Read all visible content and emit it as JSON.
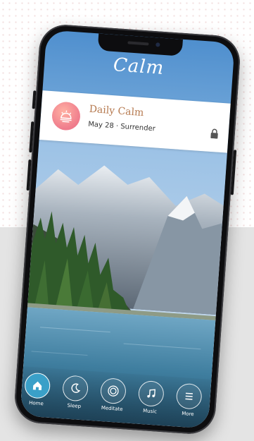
{
  "app": {
    "logo_text": "Calm"
  },
  "daily_calm": {
    "title": "Daily Calm",
    "subtitle": "May 28 · Surrender",
    "icon": "sun-icon",
    "lock_icon": "lock-icon"
  },
  "tabs": [
    {
      "label": "Home",
      "icon": "home-icon",
      "active": true
    },
    {
      "label": "Sleep",
      "icon": "moon-icon",
      "active": false
    },
    {
      "label": "Meditate",
      "icon": "meditate-icon",
      "active": false
    },
    {
      "label": "Music",
      "icon": "music-note-icon",
      "active": false
    },
    {
      "label": "More",
      "icon": "menu-icon",
      "active": false
    }
  ],
  "colors": {
    "accent": "#3aa0c8",
    "card_title": "#b67a50",
    "icon_gradient": "#ef7b8c"
  }
}
